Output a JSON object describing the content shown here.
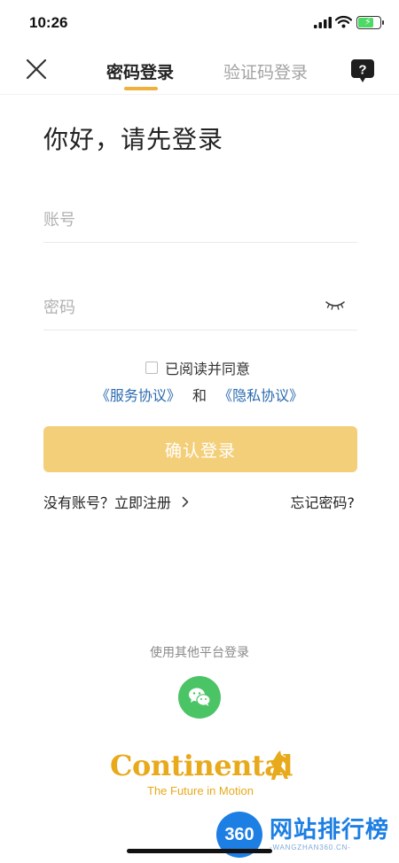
{
  "status_bar": {
    "time": "10:26",
    "icons": [
      "cellular-signal-icon",
      "wifi-icon",
      "battery-charging-icon"
    ]
  },
  "nav": {
    "tabs": [
      {
        "label": "密码登录",
        "active": true
      },
      {
        "label": "验证码登录",
        "active": false
      }
    ],
    "close_icon": "close-icon",
    "help_icon": "help-icon"
  },
  "main": {
    "title": "你好，请先登录",
    "account_placeholder": "账号",
    "password_placeholder": "密码",
    "password_visibility_icon": "eye-closed-icon",
    "agreement_text": "已阅读并同意",
    "service_agreement": "《服务协议》",
    "and_text": "和",
    "privacy_agreement": "《隐私协议》",
    "confirm_button": "确认登录",
    "register_link": "没有账号？立即注册",
    "forgot_password": "忘记密码?"
  },
  "other_login": {
    "label": "使用其他平台登录",
    "wechat_icon": "wechat-icon"
  },
  "brand": {
    "name": "Continental",
    "tagline": "The Future in Motion"
  },
  "watermark": {
    "badge": "360",
    "name_cn": "网站排行榜",
    "domain": "-WANGZHAN360.CN-"
  },
  "colors": {
    "accent": "#f0b03c",
    "confirm_button_bg": "#f4cf7a",
    "link": "#2a6aaf",
    "wechat": "#4bc466",
    "brand": "#e8a91b",
    "watermark": "#1d7fe3"
  }
}
